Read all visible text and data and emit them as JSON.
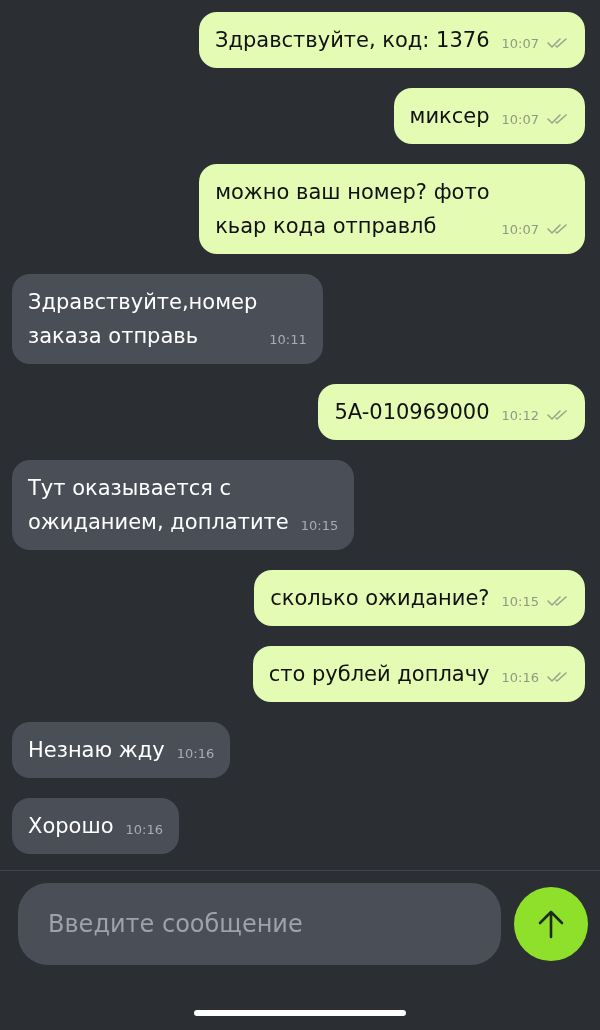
{
  "messages": [
    {
      "kind": "out",
      "text": "Здравствуйте, код: 1376",
      "time": "10:07"
    },
    {
      "kind": "out",
      "text": "миксер",
      "time": "10:07"
    },
    {
      "kind": "out",
      "text": "можно ваш номер? фото\nкьар кода отправлб",
      "time": "10:07"
    },
    {
      "kind": "in",
      "text": "Здравствуйте,номер\nзаказа отправь",
      "time": "10:11"
    },
    {
      "kind": "out",
      "text": "5A-010969000",
      "time": "10:12"
    },
    {
      "kind": "in",
      "text": "Тут оказывается с\nожиданием, доплатите",
      "time": "10:15"
    },
    {
      "kind": "out",
      "text": "сколько ожидание?",
      "time": "10:15"
    },
    {
      "kind": "out",
      "text": "сто рублей доплачу",
      "time": "10:16"
    },
    {
      "kind": "in",
      "text": "Незнаю жду",
      "time": "10:16"
    },
    {
      "kind": "in",
      "text": "Хорошо",
      "time": "10:16"
    }
  ],
  "composer": {
    "placeholder": "Введите сообщение"
  }
}
